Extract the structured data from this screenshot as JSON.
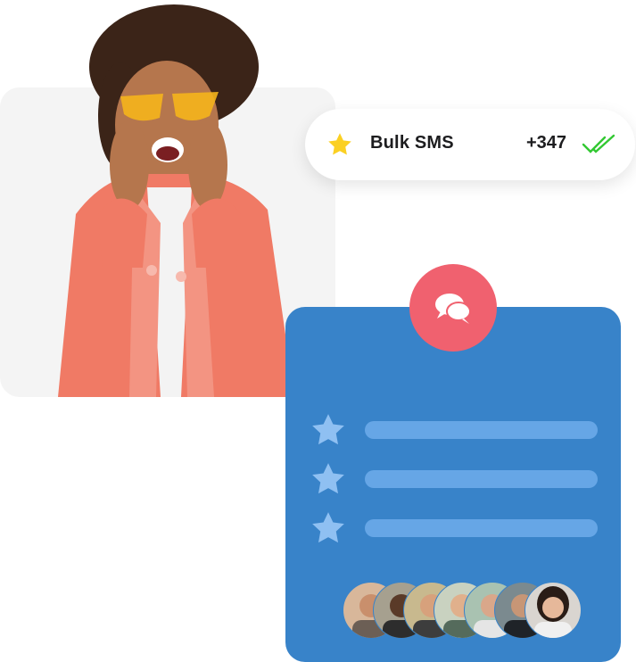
{
  "sms_card": {
    "label": "Bulk SMS",
    "count": "+347",
    "icon_star": "star-icon",
    "icon_check": "double-check-icon"
  },
  "chat_card": {
    "icon": "chat-bubbles-icon",
    "rows": [
      {
        "icon": "star-icon"
      },
      {
        "icon": "star-icon"
      },
      {
        "icon": "star-icon"
      }
    ],
    "avatar_count": 7
  },
  "colors": {
    "blue_card": "#3883c9",
    "bar": "#66a6e6",
    "badge": "#f0616f",
    "star_yellow": "#fbd023",
    "check_green": "#32c832"
  }
}
